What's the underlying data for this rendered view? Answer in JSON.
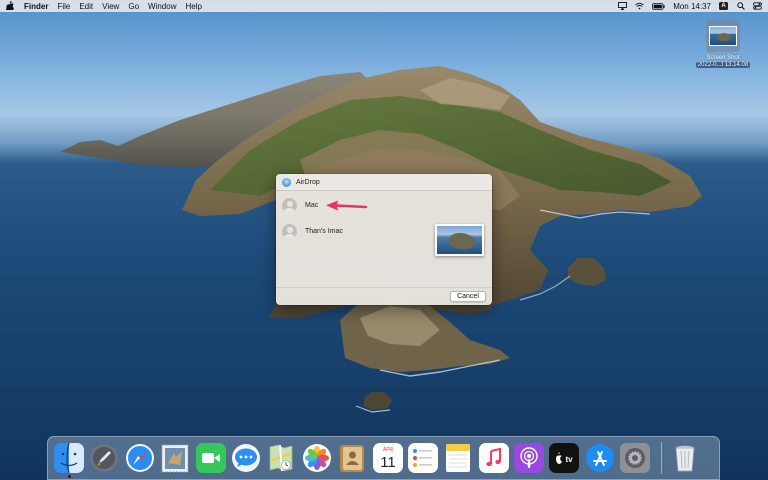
{
  "menubar": {
    "app_name": "Finder",
    "menus": [
      "File",
      "Edit",
      "View",
      "Go",
      "Window",
      "Help"
    ],
    "clock": "Mon 14:37",
    "input_source": "A",
    "status_icons": [
      "airplay-icon",
      "wifi-icon",
      "battery-icon",
      "input-source-icon",
      "spotlight-icon",
      "control-center-icon"
    ]
  },
  "desktop_file": {
    "name_line1": "Screen Shot",
    "name_line2": "2022-0...t 13.14.08"
  },
  "airdrop_sheet": {
    "title": "AirDrop",
    "recipients": [
      {
        "label": "Mac",
        "avatar": "person-icon"
      },
      {
        "label": "Than's Imac",
        "avatar": "person-icon"
      }
    ],
    "cancel_label": "Cancel",
    "arrow_color": "#e8355f"
  },
  "dock": {
    "apps": [
      "Finder",
      "Launchpad",
      "Safari",
      "Mail",
      "FaceTime",
      "Messages",
      "Maps",
      "Photos",
      "Contacts",
      "Calendar",
      "Reminders",
      "Notes",
      "Music",
      "Podcasts",
      "TV",
      "App Store",
      "System Preferences"
    ],
    "trash": "Trash",
    "calendar_month": "APR",
    "calendar_day": "11"
  }
}
